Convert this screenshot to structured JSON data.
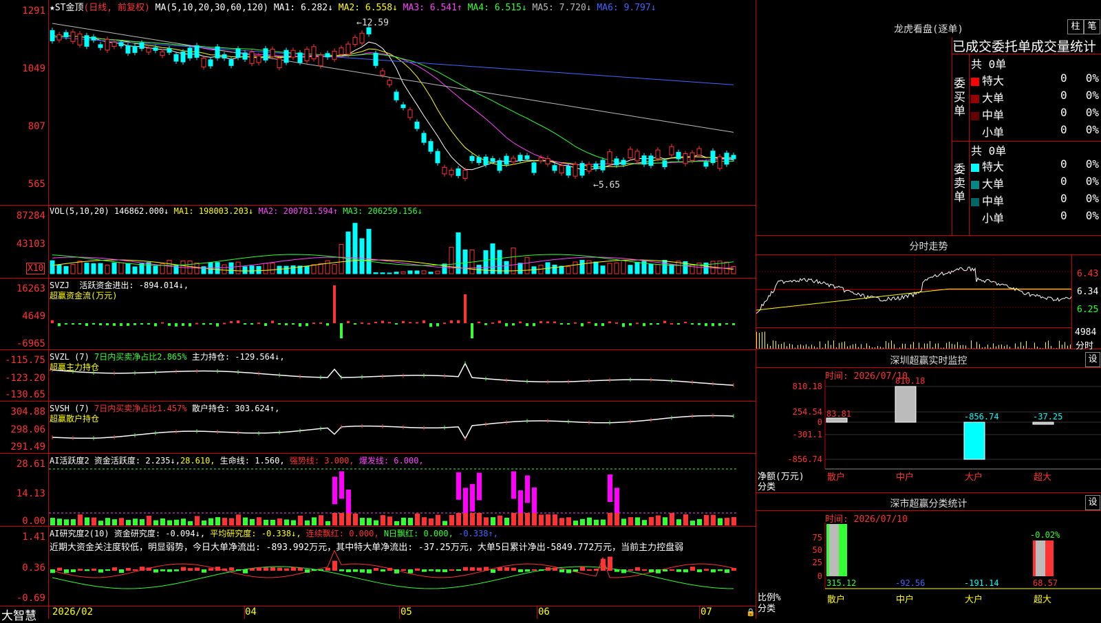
{
  "main_chart": {
    "symbol": "★ST金顶",
    "period": "(日线, 前复权)",
    "ma_label": "MA(5,10,20,30,60,120)",
    "ma": [
      {
        "name": "MA1:",
        "value": "6.282↓",
        "color": "#ffffff"
      },
      {
        "name": "MA2:",
        "value": "6.558↓",
        "color": "#ffff00"
      },
      {
        "name": "MA3:",
        "value": "6.541↑",
        "color": "#ff44ff"
      },
      {
        "name": "MA4:",
        "value": "6.515↓",
        "color": "#33ff33"
      },
      {
        "name": "MA5:",
        "value": "7.720↓",
        "color": "#bbbbbb"
      },
      {
        "name": "MA6:",
        "value": "9.797↓",
        "color": "#4466ff"
      }
    ],
    "yticks": [
      "1291",
      "1049",
      "807",
      "565"
    ],
    "hi_label": "12.59",
    "lo_label": "5.65"
  },
  "volume": {
    "title": "VOL(5,10,20)",
    "value": "146862.000↓",
    "ma": [
      {
        "name": "MA1:",
        "value": "198003.203↓",
        "color": "#ffff00"
      },
      {
        "name": "MA2:",
        "value": "200781.594↑",
        "color": "#ff44ff"
      },
      {
        "name": "MA3:",
        "value": "206259.156↓",
        "color": "#33ff33"
      }
    ],
    "yticks": [
      "87284",
      "43103"
    ],
    "unit": "X10"
  },
  "svzj": {
    "title": "SVZJ",
    "line1": "活跃资金进出: -894.014↓,",
    "line2": "超赢资金流(万元)",
    "yticks": [
      "16263",
      "4649",
      "-6965"
    ]
  },
  "svzl": {
    "title": "SVZL (7)",
    "pct": "7日内买卖净占比2.865%",
    "hold": "主力持仓: -129.564↓,",
    "line2": "超赢主力持仓",
    "yticks": [
      "-115.75",
      "-123.20",
      "-130.65"
    ]
  },
  "svsh": {
    "title": "SVSH (7)",
    "pct": "7日内买卖净占比1.457%",
    "hold": "散户持仓: 303.624↑,",
    "line2": "超赢散户持仓",
    "yticks": [
      "304.88",
      "298.06",
      "291.49"
    ]
  },
  "ai_active": {
    "title": "AI活跃度2",
    "a": "资金活跃度: 2.235↓,",
    "b": "28.610,",
    "c": "生命线: 1.560,",
    "d": "强势线: 3.000,",
    "e": "爆发线: 6.000,",
    "yticks": [
      "28.61",
      "14.13",
      "0.00"
    ]
  },
  "ai_research": {
    "title": "AI研究度2(10)",
    "a": "资金研究度: -0.094↓,",
    "b": "平均研究度: -0.338↓,",
    "c": "连续飘红: 0.000,",
    "d": "N日飘红: 0.000,",
    "e": "-0.338↑,",
    "comment": "近期大资金关注度较低，明显弱势，今日大单净流出: -893.992万元，其中特大单净流出: -37.25万元，大单5日累计净出-5849.772万元，当前主力控盘弱",
    "yticks": [
      "1.41",
      "0.36",
      "-0.69"
    ]
  },
  "xaxis": {
    "brand": "大智慧",
    "dates": [
      "2026/02",
      "04",
      "05",
      "06",
      "07"
    ]
  },
  "dragon": {
    "title": "龙虎看盘(逐单)",
    "btn1": "柱",
    "btn2": "笔",
    "subtitle": "已成交委托单成交量统计",
    "buy_label": "委买单",
    "sell_label": "委卖单",
    "buy_total": "共 0单",
    "sell_total": "共 0单",
    "buy_rows": [
      {
        "name": "特大",
        "val": "0",
        "pct": "0%",
        "color": "#ff0000"
      },
      {
        "name": "大单",
        "val": "0",
        "pct": "0%",
        "color": "#990000"
      },
      {
        "name": "中单",
        "val": "0",
        "pct": "0%",
        "color": "#660000"
      },
      {
        "name": "小单",
        "val": "0",
        "pct": "0%",
        "color": "#000000"
      }
    ],
    "sell_rows": [
      {
        "name": "特大",
        "val": "0",
        "pct": "0%",
        "color": "#00ffff"
      },
      {
        "name": "大单",
        "val": "0",
        "pct": "0%",
        "color": "#008888"
      },
      {
        "name": "中单",
        "val": "0",
        "pct": "0%",
        "color": "#006666"
      },
      {
        "name": "小单",
        "val": "0",
        "pct": "0%",
        "color": "#000000"
      }
    ]
  },
  "intraday": {
    "title": "分时走势",
    "yticks": [
      "6.43",
      "6.34",
      "6.25"
    ],
    "vol": "4984",
    "label": "分时"
  },
  "sz_monitor": {
    "title": "深圳超赢实时监控",
    "btn": "设",
    "time": "时间: 2026/07/10",
    "yticks": [
      "810.18",
      "254.54",
      "0",
      "-301.1",
      "-856.74"
    ],
    "ylabel": "净额(万元)",
    "xlabel": "分类",
    "values": [
      "83.81",
      "810.18",
      "-856.74",
      "-37.25"
    ],
    "categories": [
      "散户",
      "中户",
      "大户",
      "超大"
    ]
  },
  "sz_stats": {
    "title": "深市超赢分类统计",
    "btn": "设",
    "time": "时间: 2026/07/10",
    "yticks": [
      "75",
      "50",
      "25",
      "0"
    ],
    "ylabel": "比例%",
    "xlabel": "分类",
    "top": "-0.02%",
    "values": [
      "315.12",
      "-92.56",
      "-191.14",
      "68.57"
    ],
    "categories": [
      "散户",
      "中户",
      "大户",
      "超大"
    ]
  }
}
